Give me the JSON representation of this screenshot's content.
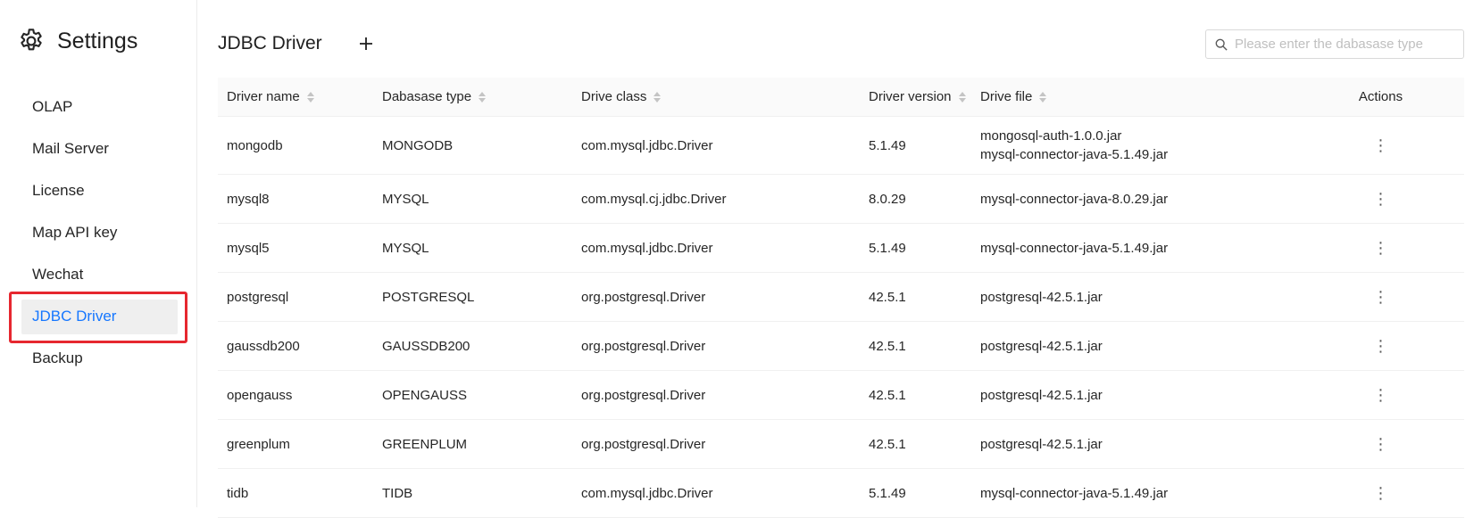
{
  "brand": {
    "title": "Settings",
    "icon": "gear-icon"
  },
  "nav": [
    {
      "label": "OLAP",
      "active": false
    },
    {
      "label": "Mail Server",
      "active": false
    },
    {
      "label": "License",
      "active": false
    },
    {
      "label": "Map API key",
      "active": false
    },
    {
      "label": "Wechat",
      "active": false
    },
    {
      "label": "JDBC Driver",
      "active": true
    },
    {
      "label": "Backup",
      "active": false
    }
  ],
  "page": {
    "title": "JDBC Driver",
    "add_icon": "plus-icon",
    "search_placeholder": "Please enter the dabasase type"
  },
  "table": {
    "columns": [
      "Driver name",
      "Dabasase type",
      "Drive class",
      "Driver version",
      "Drive file",
      "Actions"
    ],
    "rows": [
      {
        "name": "mongodb",
        "type": "MONGODB",
        "class": "com.mysql.jdbc.Driver",
        "version": "5.1.49",
        "files": [
          "mongosql-auth-1.0.0.jar",
          "mysql-connector-java-5.1.49.jar"
        ],
        "action": "⋮"
      },
      {
        "name": "mysql8",
        "type": "MYSQL",
        "class": "com.mysql.cj.jdbc.Driver",
        "version": "8.0.29",
        "files": [
          "mysql-connector-java-8.0.29.jar"
        ],
        "action": "⋮"
      },
      {
        "name": "mysql5",
        "type": "MYSQL",
        "class": "com.mysql.jdbc.Driver",
        "version": "5.1.49",
        "files": [
          "mysql-connector-java-5.1.49.jar"
        ],
        "action": "⋮"
      },
      {
        "name": "postgresql",
        "type": "POSTGRESQL",
        "class": "org.postgresql.Driver",
        "version": "42.5.1",
        "files": [
          "postgresql-42.5.1.jar"
        ],
        "action": "⋮"
      },
      {
        "name": "gaussdb200",
        "type": "GAUSSDB200",
        "class": "org.postgresql.Driver",
        "version": "42.5.1",
        "files": [
          "postgresql-42.5.1.jar"
        ],
        "action": "⋮"
      },
      {
        "name": "opengauss",
        "type": "OPENGAUSS",
        "class": "org.postgresql.Driver",
        "version": "42.5.1",
        "files": [
          "postgresql-42.5.1.jar"
        ],
        "action": "⋮"
      },
      {
        "name": "greenplum",
        "type": "GREENPLUM",
        "class": "org.postgresql.Driver",
        "version": "42.5.1",
        "files": [
          "postgresql-42.5.1.jar"
        ],
        "action": "⋮"
      },
      {
        "name": "tidb",
        "type": "TIDB",
        "class": "com.mysql.jdbc.Driver",
        "version": "5.1.49",
        "files": [
          "mysql-connector-java-5.1.49.jar"
        ],
        "action": "⋮"
      }
    ]
  },
  "colors": {
    "accent": "#1677ff",
    "highlight": "#e6272f",
    "active_bg": "#efefef"
  }
}
